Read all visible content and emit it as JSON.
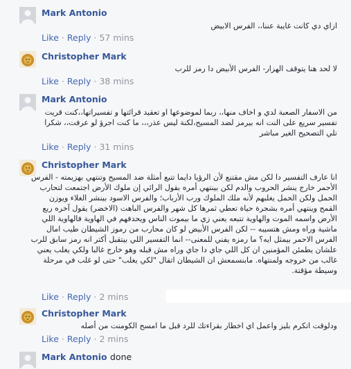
{
  "comments": [
    {
      "author": "Mark Antonio",
      "avatar": "default-avatar-icon",
      "text": "ازاي دي كانت غايبة عننا،، الفرس الابيض",
      "like": "Like",
      "reply": "Reply",
      "time": "57 mins",
      "sep": "·"
    },
    {
      "author": "Christopher Mark",
      "avatar": "lion-avatar-icon",
      "text": "لا لحد هنا يتوقف الهزار- الفرس الأبيض دا رمز للرب",
      "like": "Like",
      "reply": "Reply",
      "time": "38 mins",
      "sep": "·"
    },
    {
      "author": "Mark Antonio",
      "avatar": "default-avatar-icon",
      "text": "من الاسفار الصعبة لدي و اخاف منها،، ربما لموضوعها او تعقيد قرائتها و تفسيراتها،،كنت قريت\nتفسير سريع على النت انه بيرمز لضد المسيح،لكنة ليس عذر،،، ما كنت اجرؤ لو عرفت،، شكرا\nتلي التصحيح الغير مباشر",
      "like": "Like",
      "reply": "Reply",
      "time": "31 mins",
      "sep": "·"
    },
    {
      "author": "Christopher Mark",
      "avatar": "lion-avatar-icon",
      "text": "انا عارف التفسير دا لكن مش مقتنع لأن الرؤيا دايما تتبع أمثلة ضد المسيح وتنتهي بهزيمته - الفرس\nالأحمر خارج ينشر الحروب والدم لكن بينتهي أمره بقول الرائي إن ملوك الأرض اجتمعت لتحارب\nالحمل ولكن الحمل يغلبهم لأنه ملك الملوك ورب الأرباب؛ والفرس الاسود بينشر الغلاء ويوزن\nالقمح وينتهي أمره بشجرة حياة تعطي ثمرها كل شهر والفرس الباهت (الاخضر) يقول آخره ربع\nالأرض واسمه الموت والهاوية تتبعه يعني زي ما بيموت الناس ويحدفهم في الهاوية فالهاوية اللي\nماشية وراه ومش هتسيبه -- لكن الفرس الأبيض لو كان محارب من رموز الشيطان طيب امال\nالفرس الاحمر بيمثل ايه؟ ما رمزه يفني للمعنى-- انما التفسير اللي بيتقبل أكتر انه رمز سابق للرب\nعلشان يطمئن المؤمنين ان كل اللي جاي دا جاي وراه مش قبله وهو خارج غالبا ولكي يغلب يعني\nغالب من خروجه ولمنتهاه. مابنسمعش ان الشيطان اتقال \"لكي يغلب\" حتى لو غلب في مرحلة\nوسيطة مؤقتة.",
      "like": "Like",
      "reply": "Reply",
      "time": "2 mins",
      "sep": "·"
    },
    {
      "author": "Christopher Mark",
      "avatar": "lion-avatar-icon",
      "text": "ودلوقت اتكرم بليز واعمل اي اخطار بقراءتك للرد قبل ما امسح الكومنت من أصله",
      "like": "Like",
      "reply": "Reply",
      "time": "2 mins",
      "sep": "·"
    },
    {
      "author": "Mark Antonio",
      "avatar": "default-avatar-icon",
      "inline_text": "done"
    }
  ]
}
